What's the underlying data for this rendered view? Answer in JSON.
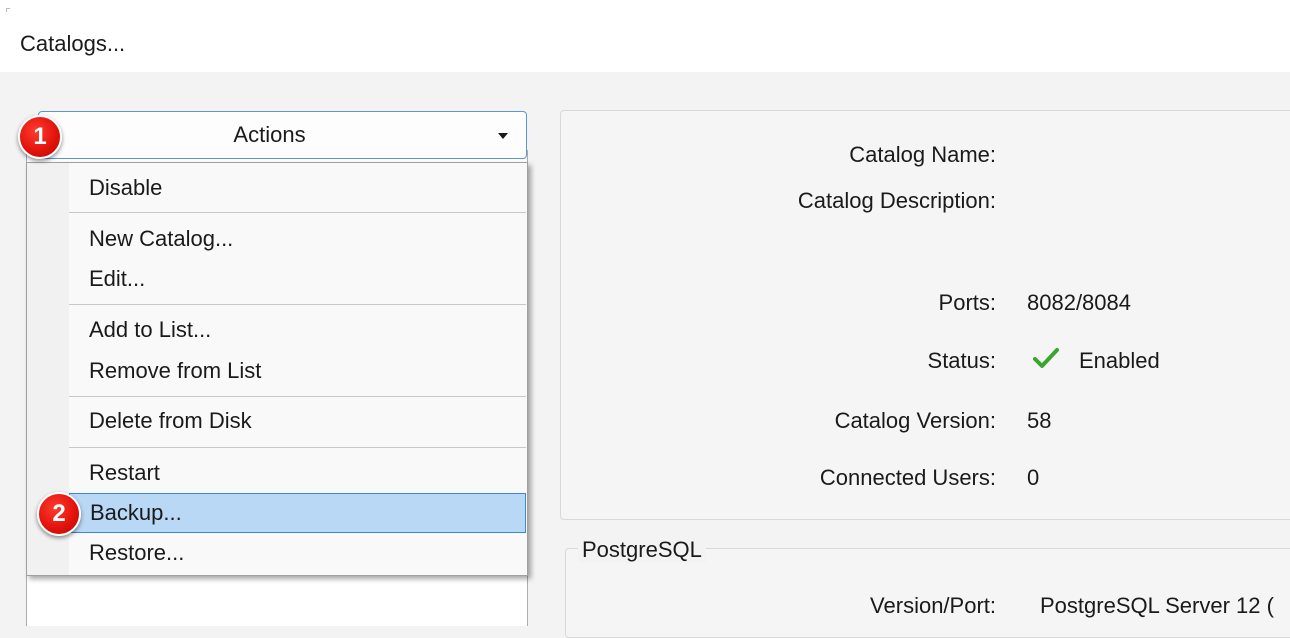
{
  "window": {
    "title": "Catalogs..."
  },
  "actions": {
    "label": "Actions"
  },
  "badges": [
    "1",
    "2"
  ],
  "menu": {
    "items": [
      {
        "label": "Disable"
      },
      {
        "label": "New Catalog..."
      },
      {
        "label": "Edit..."
      },
      {
        "label": "Add to List..."
      },
      {
        "label": "Remove from List"
      },
      {
        "label": "Delete from Disk"
      },
      {
        "label": "Restart"
      },
      {
        "label": "Backup...",
        "highlighted": true
      },
      {
        "label": "Restore..."
      }
    ]
  },
  "details": {
    "catalog_name_label": "Catalog Name:",
    "catalog_name_value": "",
    "catalog_description_label": "Catalog Description:",
    "catalog_description_value": "",
    "ports_label": "Ports:",
    "ports_value": "8082/8084",
    "status_label": "Status:",
    "status_value": "Enabled",
    "status_icon": "checkmark-icon",
    "catalog_version_label": "Catalog Version:",
    "catalog_version_value": "58",
    "connected_users_label": "Connected Users:",
    "connected_users_value": "0"
  },
  "postgres": {
    "group_title": "PostgreSQL",
    "version_port_label": "Version/Port:",
    "version_port_value": "PostgreSQL Server 12 ("
  },
  "colors": {
    "accent_border": "#5c95d6",
    "highlight": "#b9d8f5",
    "badge": "#e0110a",
    "check": "#3aa52f"
  }
}
